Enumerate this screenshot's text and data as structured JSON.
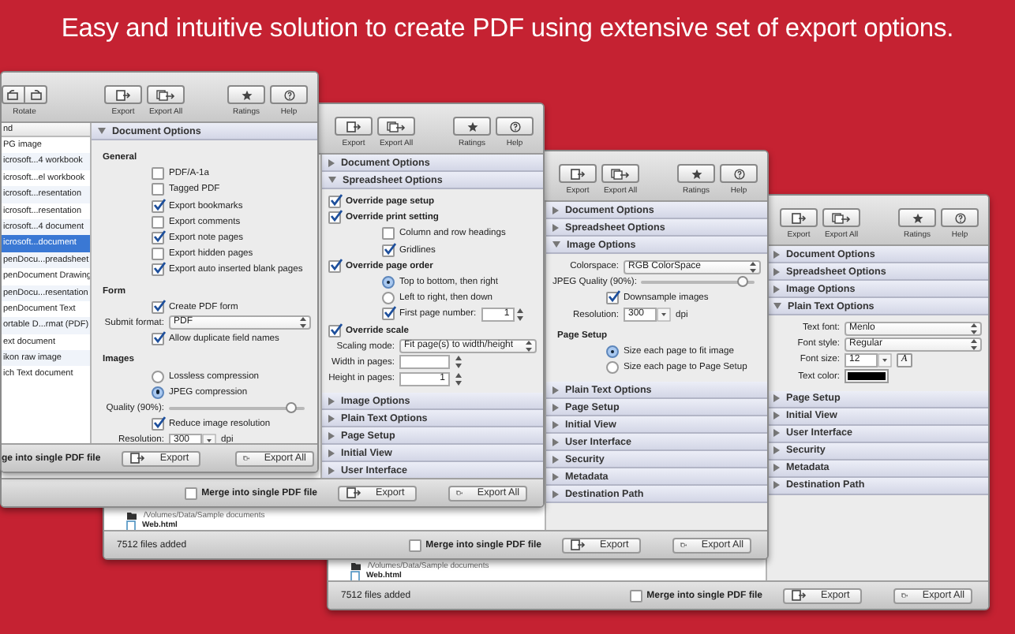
{
  "headline": "Easy and intuitive solution to create PDF using extensive set of export options.",
  "windows": [
    {
      "toolbar": [
        {
          "kind": "export",
          "label": "Export"
        },
        {
          "kind": "export-all",
          "label": "Export All"
        },
        {
          "kind": "ratings",
          "label": "Ratings"
        },
        {
          "kind": "help",
          "label": "Help"
        }
      ],
      "files": [
        {
          "kind": "path",
          "name": "/Volumes/Data/Sample documents"
        },
        {
          "kind": "file",
          "name": "Web.html"
        }
      ],
      "sections": [
        {
          "title": "Document Options",
          "expanded": false
        },
        {
          "title": "Spreadsheet Options",
          "expanded": false
        },
        {
          "title": "Image Options",
          "expanded": false
        },
        {
          "title": "Plain Text Options",
          "expanded": true,
          "rows": [
            {
              "kind": "select",
              "label": "Text font:",
              "value": "Menlo"
            },
            {
              "kind": "select",
              "label": "Font style:",
              "value": "Regular"
            },
            {
              "kind": "combo",
              "label": "Font size:",
              "value": "12",
              "button": "A"
            },
            {
              "kind": "color",
              "label": "Text color:",
              "color": "#000000"
            }
          ]
        },
        {
          "title": "Page Setup",
          "expanded": false
        },
        {
          "title": "Initial View",
          "expanded": false
        },
        {
          "title": "User Interface",
          "expanded": false
        },
        {
          "title": "Security",
          "expanded": false
        },
        {
          "title": "Metadata",
          "expanded": false
        },
        {
          "title": "Destination Path",
          "expanded": false
        }
      ],
      "bottom": {
        "status": "7512 files added",
        "merge": {
          "label": "Merge into single PDF file",
          "checked": false
        },
        "buttons": [
          {
            "kind": "export",
            "label": "Export"
          },
          {
            "kind": "export-all",
            "label": "Export All"
          }
        ]
      }
    },
    {
      "toolbar": [
        {
          "kind": "export",
          "label": "Export"
        },
        {
          "kind": "export-all",
          "label": "Export All"
        },
        {
          "kind": "ratings",
          "label": "Ratings"
        },
        {
          "kind": "help",
          "label": "Help"
        }
      ],
      "files": [
        {
          "kind": "path",
          "name": "/Volumes/Data/Sample documents"
        },
        {
          "kind": "file",
          "name": "Web.html"
        }
      ],
      "sections": [
        {
          "title": "Document Options",
          "expanded": false
        },
        {
          "title": "Spreadsheet Options",
          "expanded": false
        },
        {
          "title": "Image Options",
          "expanded": true,
          "rows": [
            {
              "kind": "select",
              "label": "Colorspace:",
              "value": "RGB ColorSpace"
            },
            {
              "kind": "slider",
              "label": "JPEG Quality (90%):",
              "level": 0.9
            },
            {
              "kind": "check",
              "text": "Downsample images",
              "checked": true
            },
            {
              "kind": "combo",
              "label": "Resolution:",
              "value": "300",
              "unit": "dpi"
            },
            {
              "kind": "group",
              "text": "Page Setup",
              "children": [
                {
                  "kind": "radio",
                  "text": "Size each page to fit image",
                  "selected": true
                },
                {
                  "kind": "radio",
                  "text": "Size each page to Page Setup",
                  "selected": false
                }
              ]
            }
          ]
        },
        {
          "title": "Plain Text Options",
          "expanded": false
        },
        {
          "title": "Page Setup",
          "expanded": false
        },
        {
          "title": "Initial View",
          "expanded": false
        },
        {
          "title": "User Interface",
          "expanded": false
        },
        {
          "title": "Security",
          "expanded": false
        },
        {
          "title": "Metadata",
          "expanded": false
        },
        {
          "title": "Destination Path",
          "expanded": false
        }
      ],
      "bottom": {
        "status": "7512 files added",
        "merge": {
          "label": "Merge into single PDF file",
          "checked": false
        },
        "buttons": [
          {
            "kind": "export",
            "label": "Export"
          },
          {
            "kind": "export-all",
            "label": "Export All"
          }
        ]
      }
    },
    {
      "toolbar": [
        {
          "kind": "export",
          "label": "Export"
        },
        {
          "kind": "export-all",
          "label": "Export All"
        },
        {
          "kind": "ratings",
          "label": "Ratings"
        },
        {
          "kind": "help",
          "label": "Help"
        }
      ],
      "sections": [
        {
          "title": "Document Options",
          "expanded": false
        },
        {
          "title": "Spreadsheet Options",
          "expanded": true,
          "rows": [
            {
              "kind": "check",
              "text": "Override page setup",
              "checked": true,
              "bold": true
            },
            {
              "kind": "check",
              "text": "Override print setting",
              "checked": true,
              "bold": true,
              "children": [
                {
                  "kind": "check",
                  "text": "Column and row headings",
                  "checked": false
                },
                {
                  "kind": "check",
                  "text": "Gridlines",
                  "checked": true
                }
              ]
            },
            {
              "kind": "check",
              "text": "Override page order",
              "checked": true,
              "bold": true,
              "children": [
                {
                  "kind": "radio",
                  "text": "Top to bottom, then right",
                  "selected": true
                },
                {
                  "kind": "radio",
                  "text": "Left to right, then down",
                  "selected": false
                },
                {
                  "kind": "check",
                  "text": "First page number:",
                  "checked": true,
                  "value": "1"
                }
              ]
            },
            {
              "kind": "check",
              "text": "Override scale",
              "checked": true,
              "bold": true,
              "children": [
                {
                  "kind": "select",
                  "label": "Scaling mode:",
                  "value": "Fit page(s) to width/height"
                },
                {
                  "kind": "stepper",
                  "label": "Width in pages:"
                },
                {
                  "kind": "stepper",
                  "label": "Height in pages:",
                  "value": "1"
                }
              ]
            }
          ]
        },
        {
          "title": "Image Options",
          "expanded": false
        },
        {
          "title": "Plain Text Options",
          "expanded": false
        },
        {
          "title": "Page Setup",
          "expanded": false
        },
        {
          "title": "Initial View",
          "expanded": false
        },
        {
          "title": "User Interface",
          "expanded": false
        }
      ],
      "bottom": {
        "merge": {
          "label": "Merge into single PDF file",
          "checked": false
        },
        "buttons": [
          {
            "kind": "export",
            "label": "Export"
          },
          {
            "kind": "export-all",
            "label": "Export All"
          }
        ]
      }
    },
    {
      "toolbar": [
        {
          "kind": "rotate",
          "label": "Rotate"
        },
        {
          "kind": "export",
          "label": "Export"
        },
        {
          "kind": "export-all",
          "label": "Export All"
        },
        {
          "kind": "ratings",
          "label": "Ratings"
        },
        {
          "kind": "help",
          "label": "Help"
        }
      ],
      "list": {
        "header": "nd",
        "items": [
          {
            "name": "PG image",
            "selected": false
          },
          {
            "name": "icrosoft...4 workbook",
            "selected": false
          },
          {
            "name": "icrosoft...el workbook",
            "selected": false
          },
          {
            "name": "icrosoft...resentation",
            "selected": false
          },
          {
            "name": "icrosoft...resentation",
            "selected": false
          },
          {
            "name": "icrosoft...4 document",
            "selected": false
          },
          {
            "name": "icrosoft...document",
            "selected": true
          },
          {
            "name": "penDocu...preadsheet",
            "selected": false
          },
          {
            "name": "penDocument Drawing",
            "selected": false
          },
          {
            "name": "penDocu...resentation",
            "selected": false
          },
          {
            "name": "penDocument Text",
            "selected": false
          },
          {
            "name": "ortable D...rmat (PDF)",
            "selected": false
          },
          {
            "name": "ext document",
            "selected": false
          },
          {
            "name": "ikon raw image",
            "selected": false
          },
          {
            "name": "ich Text document",
            "selected": false
          }
        ]
      },
      "sections": [
        {
          "title": "Document Options",
          "expanded": true,
          "rows": [
            {
              "kind": "group",
              "text": "General",
              "children": [
                {
                  "kind": "check",
                  "text": "PDF/A-1a",
                  "checked": false
                },
                {
                  "kind": "check",
                  "text": "Tagged PDF",
                  "checked": false
                },
                {
                  "kind": "check",
                  "text": "Export bookmarks",
                  "checked": true
                },
                {
                  "kind": "check",
                  "text": "Export comments",
                  "checked": false
                },
                {
                  "kind": "check",
                  "text": "Export note pages",
                  "checked": true
                },
                {
                  "kind": "check",
                  "text": "Export hidden pages",
                  "checked": false
                },
                {
                  "kind": "check",
                  "text": "Export auto inserted blank pages",
                  "checked": true
                }
              ]
            },
            {
              "kind": "group",
              "text": "Form",
              "children": [
                {
                  "kind": "check",
                  "text": "Create PDF form",
                  "checked": true
                },
                {
                  "kind": "select",
                  "label": "Submit format:",
                  "value": "PDF"
                },
                {
                  "kind": "check",
                  "text": "Allow duplicate field names",
                  "checked": true
                }
              ]
            },
            {
              "kind": "group",
              "text": "Images",
              "children": [
                {
                  "kind": "radio",
                  "text": "Lossless compression",
                  "selected": false
                },
                {
                  "kind": "radio",
                  "text": "JPEG compression",
                  "selected": true
                },
                {
                  "kind": "slider",
                  "label": "Quality (90%):",
                  "level": 0.9
                },
                {
                  "kind": "check",
                  "text": "Reduce image resolution",
                  "checked": true
                },
                {
                  "kind": "combo",
                  "label": "Resolution:",
                  "value": "300",
                  "unit": "dpi"
                }
              ]
            }
          ]
        }
      ],
      "bottom": {
        "merge": {
          "label": "ge into single PDF file"
        },
        "buttons": [
          {
            "kind": "export",
            "label": "Export"
          },
          {
            "kind": "export-all",
            "label": "Export All"
          }
        ]
      }
    }
  ]
}
